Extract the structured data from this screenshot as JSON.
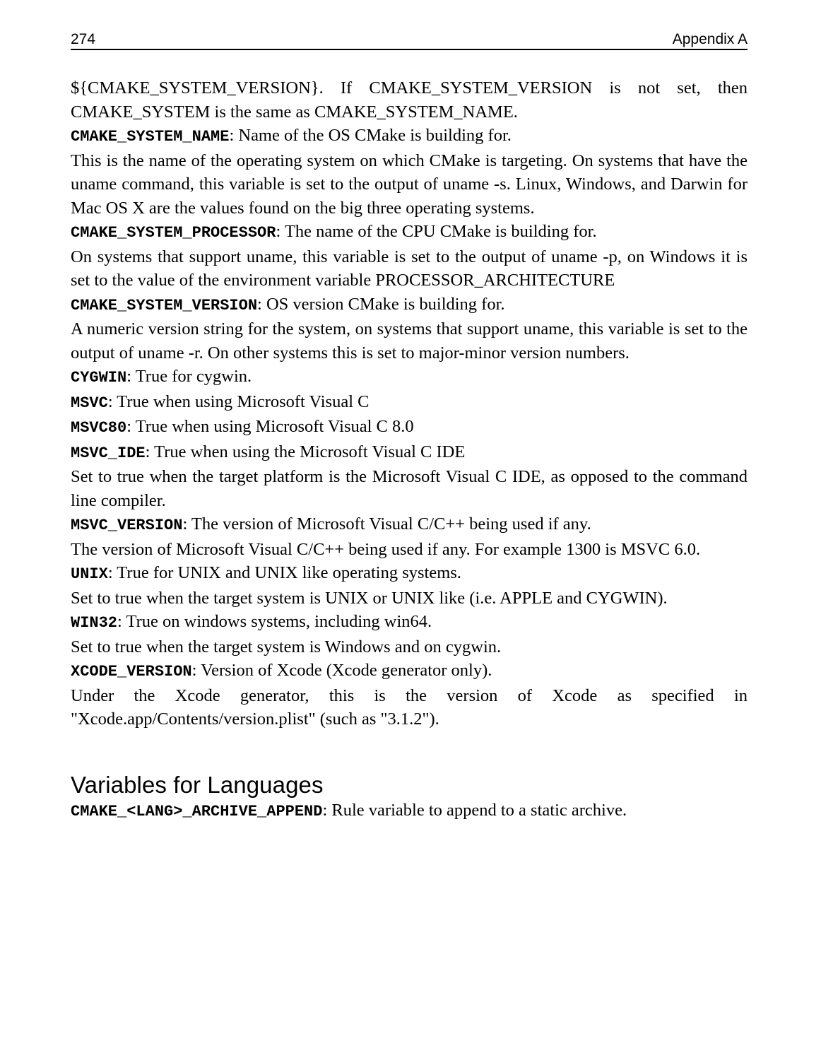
{
  "header": {
    "page_number": "274",
    "chapter": "Appendix A"
  },
  "section_heading": "Variables for Languages",
  "intro_paragraph": "${CMAKE_SYSTEM_VERSION}. If CMAKE_SYSTEM_VERSION is not set, then CMAKE_SYSTEM is the same as CMAKE_SYSTEM_NAME.",
  "entries": [
    {
      "name": "CMAKE_SYSTEM_NAME",
      "summary": ": Name of the OS CMake is building for.",
      "body": "This is the name of the operating system on which CMake is targeting. On systems that have the uname command, this variable is set to the output of uname -s. Linux, Windows, and Darwin for Mac OS X are the values found on the big three operating systems."
    },
    {
      "name": "CMAKE_SYSTEM_PROCESSOR",
      "summary": ": The name of the CPU CMake is building for.",
      "body": "On systems that support uname, this variable is set to the output of uname -p, on Windows it is set to the value of the environment variable PROCESSOR_ARCHITECTURE"
    },
    {
      "name": "CMAKE_SYSTEM_VERSION",
      "summary": ": OS version CMake is building for.",
      "body": "A numeric version string for the system, on systems that support uname, this variable is set to the output of uname -r. On other systems this is set to major-minor version numbers."
    },
    {
      "name": "CYGWIN",
      "summary": ": True for cygwin.",
      "body": ""
    },
    {
      "name": "MSVC",
      "summary": ": True when using Microsoft Visual C",
      "body": ""
    },
    {
      "name": "MSVC80",
      "summary": ": True when using Microsoft Visual C 8.0",
      "body": ""
    },
    {
      "name": "MSVC_IDE",
      "summary": ": True when using the Microsoft Visual C IDE",
      "body": "Set to true when the target platform is the Microsoft Visual C IDE, as opposed to the command line compiler."
    },
    {
      "name": "MSVC_VERSION",
      "summary": ": The version of Microsoft Visual C/C++ being used if any.",
      "body": "The version of Microsoft Visual C/C++ being used if any. For example 1300 is MSVC 6.0."
    },
    {
      "name": "UNIX",
      "summary": ": True for UNIX and UNIX like operating systems.",
      "body": "Set to true when the target system is UNIX or UNIX like (i.e. APPLE and CYGWIN)."
    },
    {
      "name": "WIN32",
      "summary": ": True on windows systems, including win64.",
      "body": "Set to true when the target system is Windows and on cygwin."
    },
    {
      "name": "XCODE_VERSION",
      "summary": ": Version of Xcode (Xcode generator only).",
      "body": "Under the Xcode generator, this is the version of Xcode as specified in \"Xcode.app/Contents/version.plist\" (such as \"3.1.2\")."
    },
    {
      "name": "CMAKE_<LANG>_ARCHIVE_APPEND",
      "summary": ": Rule variable to append to a static archive.",
      "body": ""
    }
  ]
}
